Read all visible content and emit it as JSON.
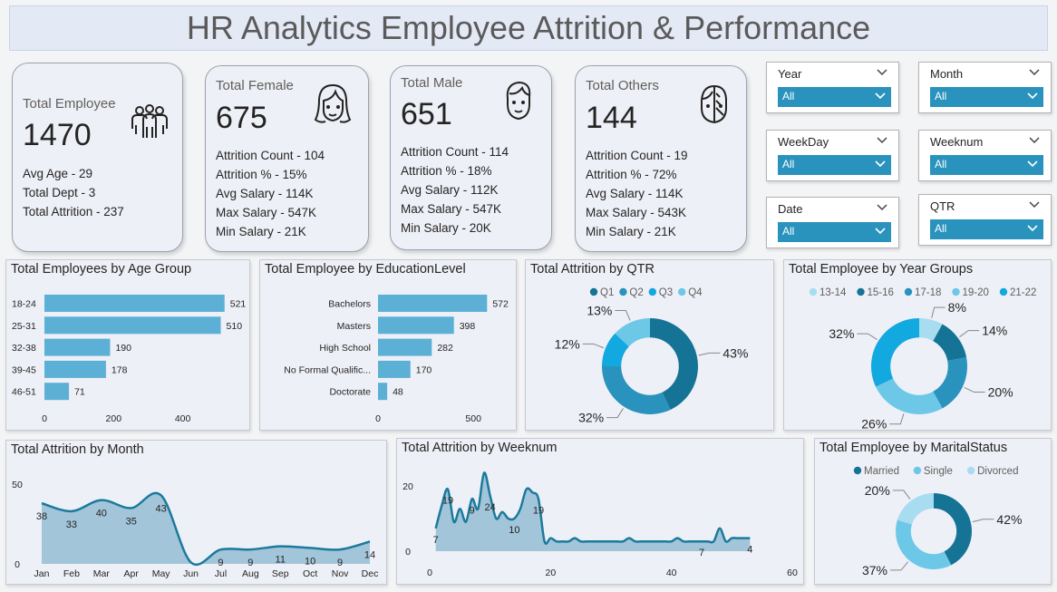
{
  "title": "HR Analytics Employee Attrition & Performance",
  "kpis": {
    "total": {
      "label": "Total Employee",
      "value": "1470",
      "lines": [
        "Avg Age - 29",
        "Total Dept - 3",
        "Total Attrition - 237"
      ]
    },
    "female": {
      "label": "Total Female",
      "value": "675",
      "lines": [
        "Attrition Count - 104",
        "Attrition % - 15%",
        "Avg Salary - 114K",
        "Max Salary - 547K",
        "Min Salary - 21K"
      ]
    },
    "male": {
      "label": "Total Male",
      "value": "651",
      "lines": [
        "Attrition Count - 114",
        "Attrition % - 18%",
        "Avg Salary - 112K",
        "Max Salary - 547K",
        "Min Salary - 20K"
      ]
    },
    "others": {
      "label": "Total Others",
      "value": "144",
      "lines": [
        "Attrition Count - 19",
        "Attrition % - 72%",
        "Avg Salary - 114K",
        "Max Salary - 543K",
        "Min Salary - 21K"
      ]
    }
  },
  "slicers": [
    {
      "label": "Year",
      "value": "All"
    },
    {
      "label": "Month",
      "value": "All"
    },
    {
      "label": "WeekDay",
      "value": "All"
    },
    {
      "label": "Weeknum",
      "value": "All"
    },
    {
      "label": "Date",
      "value": "All"
    },
    {
      "label": "QTR",
      "value": "All"
    }
  ],
  "colors": {
    "bar": "#5cb0d6",
    "area_fill": "#94bdd3",
    "area_line": "#1b7a9c",
    "dark": "#157396",
    "mid": "#2a93bd",
    "bright": "#12a8e0",
    "light": "#6dc8e8",
    "pale": "#a8dcf0"
  },
  "chart_data": [
    {
      "type": "bar",
      "title": "Total Employees by Age Group",
      "categories": [
        "18-24",
        "25-31",
        "32-38",
        "39-45",
        "46-51"
      ],
      "values": [
        521,
        510,
        190,
        178,
        71
      ],
      "xticks": [
        "0",
        "200",
        "400"
      ],
      "xlim": [
        0,
        540
      ]
    },
    {
      "type": "bar",
      "title": "Total Employee by EducationLevel",
      "categories": [
        "Bachelors",
        "Masters",
        "High School",
        "No Formal Qualific...",
        "Doctorate"
      ],
      "values": [
        572,
        398,
        282,
        170,
        48
      ],
      "xticks": [
        "0",
        "500"
      ],
      "xlim": [
        0,
        580
      ]
    },
    {
      "type": "pie",
      "title": "Total Attrition by QTR",
      "legend": [
        "Q1",
        "Q2",
        "Q3",
        "Q4"
      ],
      "values": [
        43,
        32,
        12,
        13
      ],
      "labels": [
        "43%",
        "32%",
        "12%",
        "13%"
      ]
    },
    {
      "type": "pie",
      "title": "Total Employee by Year Groups",
      "legend": [
        "13-14",
        "15-16",
        "17-18",
        "19-20",
        "21-22"
      ],
      "values": [
        8,
        14,
        20,
        26,
        32
      ],
      "labels": [
        "8%",
        "14%",
        "20%",
        "26%",
        "32%"
      ]
    },
    {
      "type": "area",
      "title": "Total Attrition by Month",
      "categories": [
        "Jan",
        "Feb",
        "Mar",
        "Apr",
        "May",
        "Jun",
        "Jul",
        "Aug",
        "Sep",
        "Oct",
        "Nov",
        "Dec"
      ],
      "values": [
        38,
        33,
        40,
        35,
        43,
        1,
        9,
        9,
        11,
        10,
        9,
        14
      ],
      "labels": [
        "38",
        "33",
        "40",
        "35",
        "43",
        "",
        "9",
        "9",
        "11",
        "10",
        "9",
        "14"
      ],
      "yticks": [
        "50",
        "0"
      ],
      "ylim": [
        0,
        50
      ]
    },
    {
      "type": "area",
      "title": "Total Attrition by Weeknum",
      "x": [
        1,
        2,
        3,
        4,
        5,
        6,
        7,
        8,
        9,
        10,
        11,
        12,
        13,
        14,
        15,
        16,
        17,
        18,
        19,
        20,
        21,
        22,
        23,
        24,
        25,
        26,
        27,
        28,
        29,
        30,
        31,
        32,
        33,
        34,
        35,
        36,
        37,
        38,
        39,
        40,
        41,
        42,
        43,
        44,
        45,
        46,
        47,
        48,
        49,
        50,
        51,
        52,
        53
      ],
      "values": [
        7,
        14,
        19,
        9,
        13,
        9,
        16,
        13,
        24,
        17,
        10,
        12,
        10,
        10,
        13,
        19,
        18,
        16,
        3,
        4,
        3,
        3,
        3,
        4,
        3,
        3,
        3,
        3,
        3,
        3,
        3,
        3,
        4,
        3,
        3,
        3,
        3,
        3,
        3,
        3,
        4,
        3,
        3,
        3,
        3,
        3,
        3,
        7,
        3,
        4,
        4,
        4,
        4
      ],
      "labels": [
        {
          "x": 1,
          "text": "7"
        },
        {
          "x": 3,
          "text": "19"
        },
        {
          "x": 7,
          "text": "9"
        },
        {
          "x": 10,
          "text": "24"
        },
        {
          "x": 14,
          "text": "10"
        },
        {
          "x": 18,
          "text": "19"
        },
        {
          "x": 45,
          "text": "7"
        },
        {
          "x": 53,
          "text": "4"
        }
      ],
      "xticks": [
        "0",
        "20",
        "40",
        "60"
      ],
      "yticks": [
        "20",
        "0"
      ],
      "xlim": [
        0,
        60
      ],
      "ylim": [
        0,
        25
      ]
    },
    {
      "type": "pie",
      "title": "Total Employee by MaritalStatus",
      "legend": [
        "Married",
        "Single",
        "Divorced"
      ],
      "values": [
        42,
        37,
        20
      ],
      "labels": [
        "42%",
        "37%",
        "20%"
      ]
    }
  ]
}
